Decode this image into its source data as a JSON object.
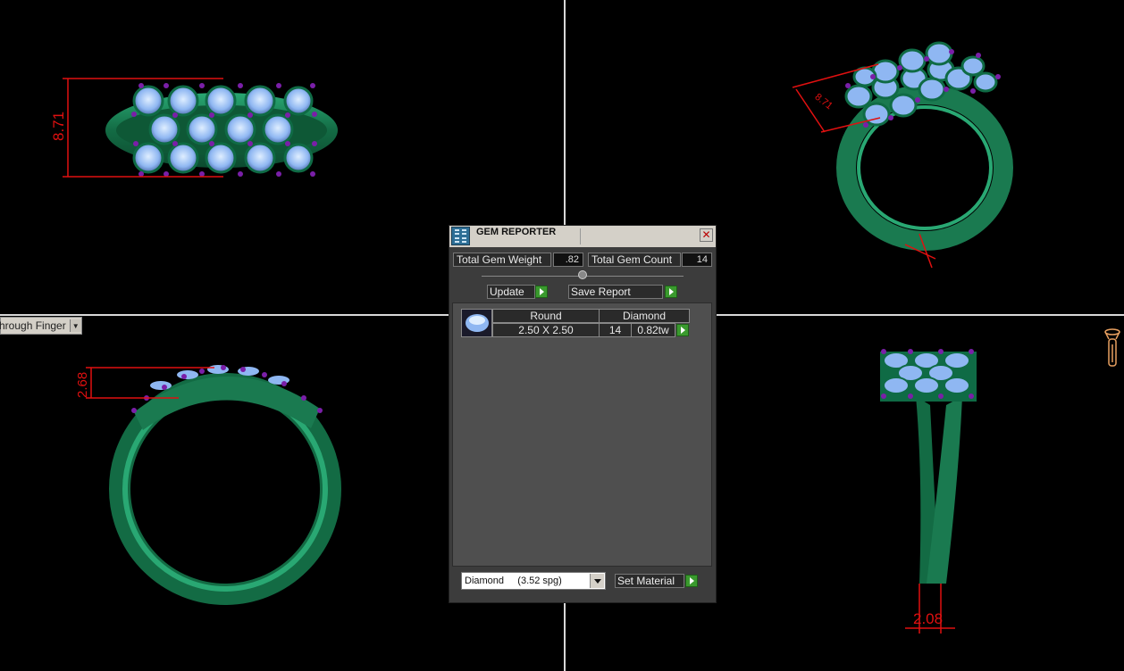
{
  "dimensions": {
    "top_left": "8.71",
    "top_right": "8.71",
    "bottom_left": "2.68",
    "bottom_right": "2.08"
  },
  "view_dropdown": {
    "label": "hrough Finger"
  },
  "dialog": {
    "title": "GEM REPORTER",
    "total_gem_weight_label": "Total Gem Weight",
    "total_gem_weight_value": ".82",
    "total_gem_count_label": "Total Gem Count",
    "total_gem_count_value": "14",
    "update_label": "Update",
    "save_report_label": "Save Report",
    "report": {
      "columns": [
        "Round",
        "Diamond"
      ],
      "rows": [
        {
          "size": "2.50 X 2.50",
          "count": "14",
          "weight": "0.82tw"
        }
      ]
    },
    "material": {
      "selected": "Diamond     (3.52 spg)"
    },
    "set_material_label": "Set Material"
  },
  "colors": {
    "metal": "#1f8a5c",
    "gem": "#8fb7f2",
    "prong": "#7a1fa8",
    "dimension": "#e01010"
  }
}
